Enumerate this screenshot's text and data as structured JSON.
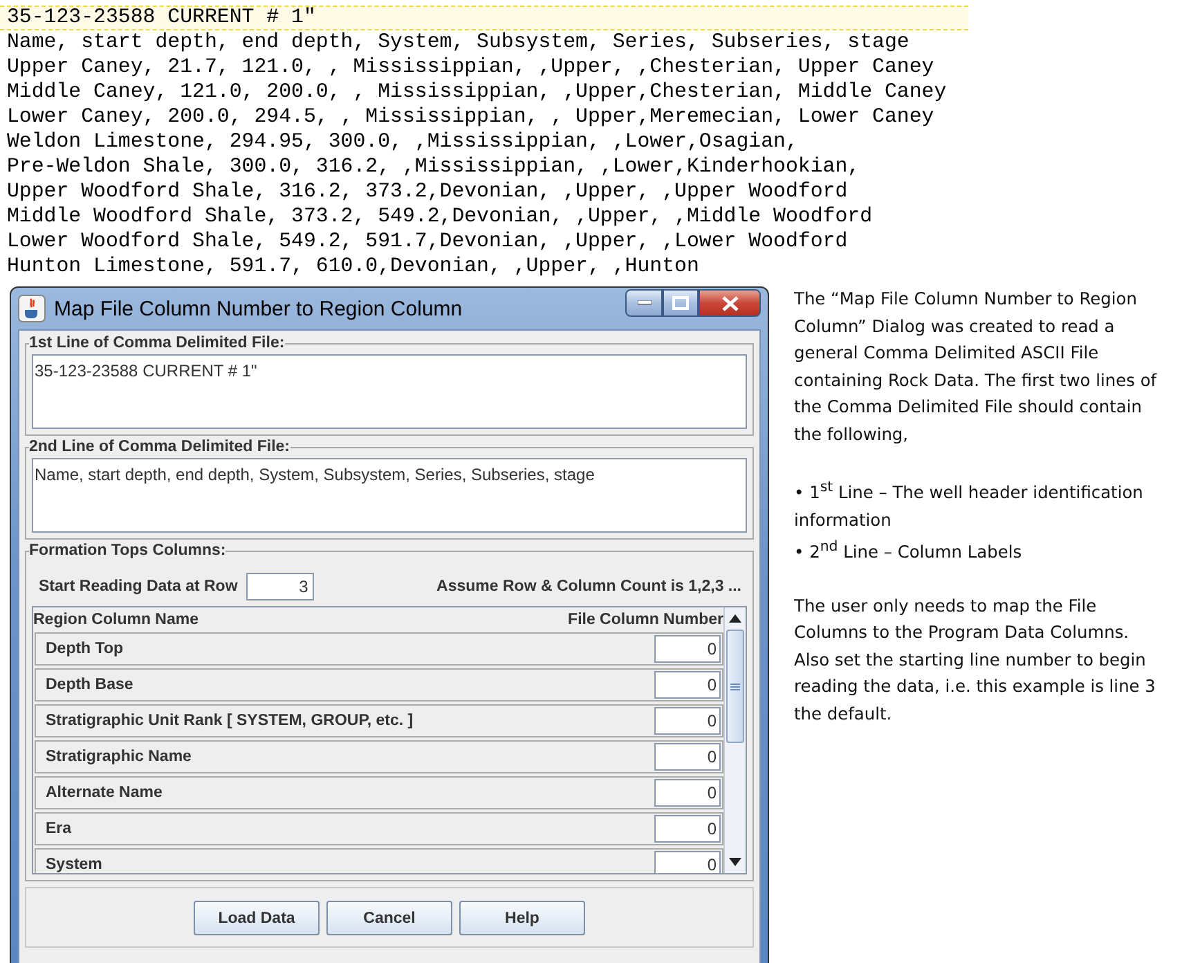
{
  "file_listing": {
    "lines": [
      {
        "text": "35-123-23588 CURRENT # 1\"",
        "selected": true
      },
      {
        "text": "Name, start depth, end depth, System, Subsystem, Series, Subseries, stage",
        "selected": false
      },
      {
        "text": "Upper Caney, 21.7, 121.0, , Mississippian, ,Upper, ,Chesterian, Upper Caney",
        "selected": false
      },
      {
        "text": "Middle Caney, 121.0, 200.0, , Mississippian, ,Upper,Chesterian, Middle Caney",
        "selected": false
      },
      {
        "text": "Lower Caney, 200.0, 294.5, , Mississippian, , Upper,Meremecian, Lower Caney",
        "selected": false
      },
      {
        "text": "Weldon Limestone, 294.95, 300.0, ,Mississippian, ,Lower,Osagian,",
        "selected": false
      },
      {
        "text": "Pre-Weldon Shale, 300.0, 316.2, ,Mississippian, ,Lower,Kinderhookian,",
        "selected": false
      },
      {
        "text": "Upper Woodford Shale, 316.2, 373.2,Devonian, ,Upper, ,Upper Woodford",
        "selected": false
      },
      {
        "text": "Middle Woodford Shale, 373.2, 549.2,Devonian, ,Upper, ,Middle Woodford",
        "selected": false
      },
      {
        "text": "Lower Woodford Shale, 549.2, 591.7,Devonian, ,Upper, ,Lower Woodford",
        "selected": false
      },
      {
        "text": "Hunton Limestone, 591.7, 610.0,Devonian, ,Upper, ,Hunton",
        "selected": false
      }
    ]
  },
  "dialog": {
    "title": "Map File Column Number to Region Column",
    "first_line": {
      "label": "1st Line of Comma Delimited File:",
      "value": "35-123-23588 CURRENT # 1\""
    },
    "second_line": {
      "label": "2nd Line of Comma Delimited File:",
      "value": "Name, start depth, end depth, System, Subsystem, Series, Subseries, stage"
    },
    "formation_tops": {
      "label": "Formation Tops Columns:",
      "start_row_label": "Start Reading Data at Row",
      "start_row_value": "3",
      "note": "Assume Row & Column Count is 1,2,3 ...",
      "columns": [
        "Region Column Name",
        "File Column Number"
      ],
      "rows": [
        {
          "name": "Depth Top",
          "value": "0"
        },
        {
          "name": "Depth Base",
          "value": "0"
        },
        {
          "name": "Stratigraphic Unit Rank [ SYSTEM, GROUP, etc. ]",
          "value": "0"
        },
        {
          "name": "Stratigraphic Name",
          "value": "0"
        },
        {
          "name": "Alternate Name",
          "value": "0"
        },
        {
          "name": "Era",
          "value": "0"
        },
        {
          "name": "System",
          "value": "0"
        }
      ]
    },
    "buttons": [
      "Load Data",
      "Cancel",
      "Help"
    ]
  },
  "description": {
    "intro": "The “Map File Column Number to Region Column” Dialog was created to read a general Comma Delimited ASCII File containing Rock Data.  The first two lines of the Comma Delimited File should contain the following,",
    "bullets": [
      "• 1$^{st}$ Line – The well header identification information",
      "• 2$^{nd}$ Line – Column Labels"
    ],
    "outro": "The user only needs to map the File Columns to the Program Data Columns. Also set the starting line number to begin reading the data, i.e. this example is line 3 the default."
  }
}
